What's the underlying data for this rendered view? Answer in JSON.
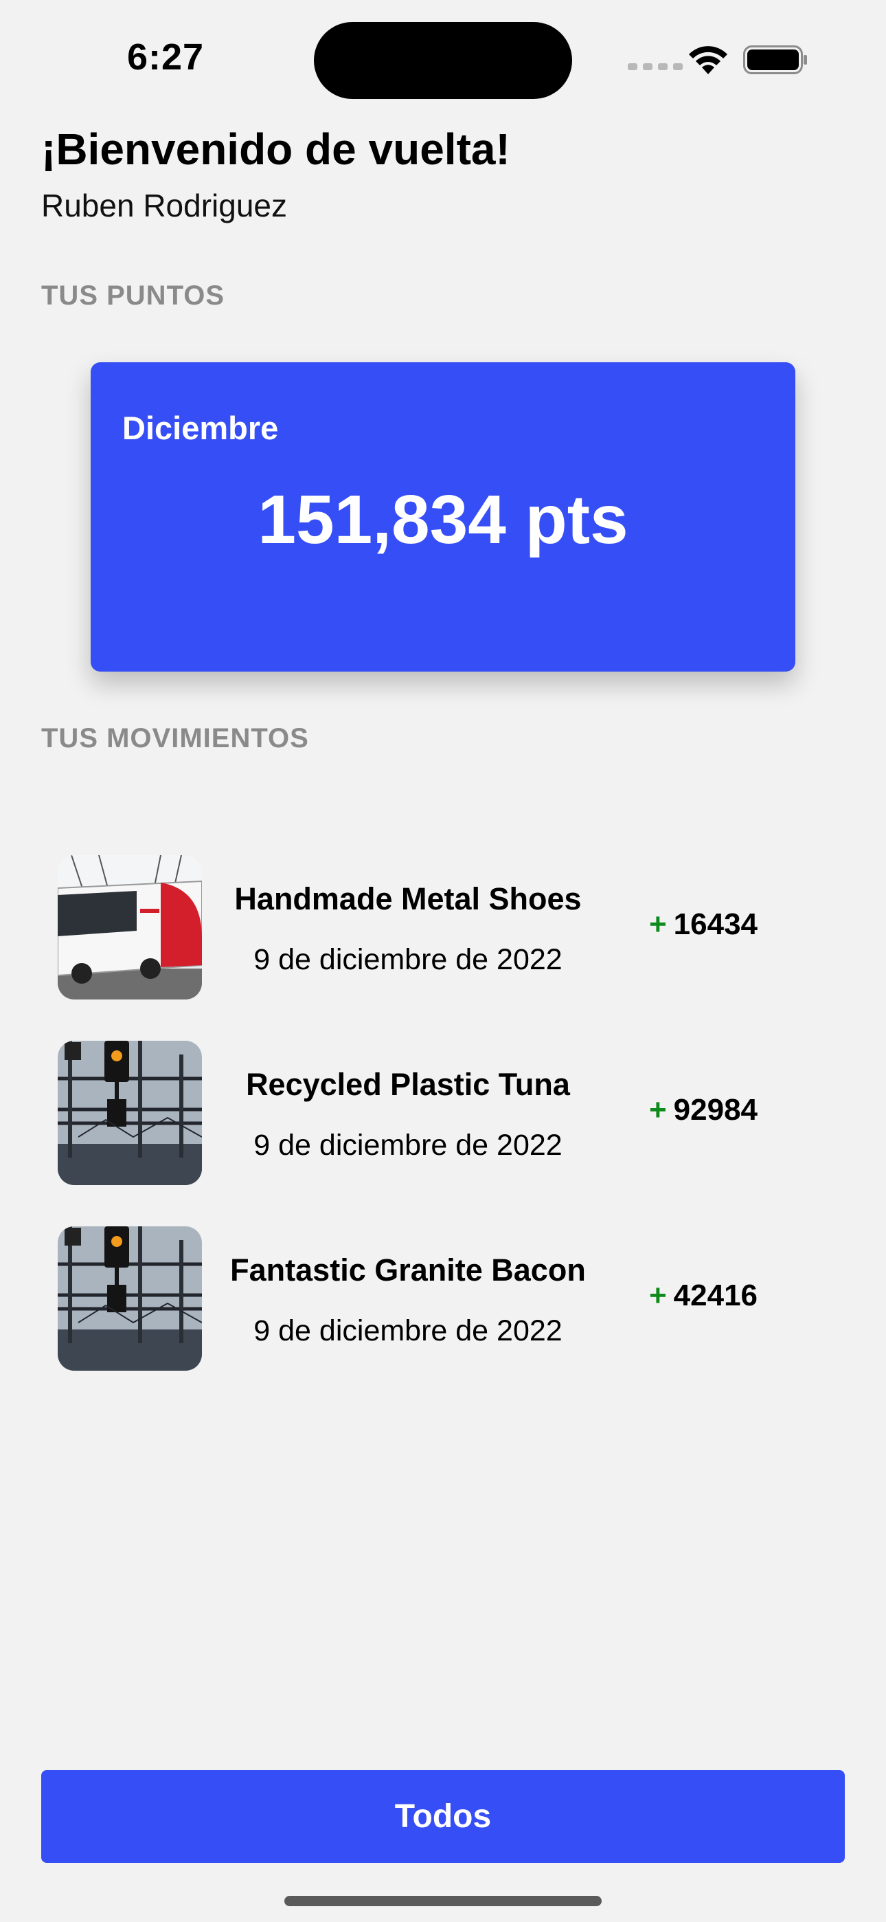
{
  "status_bar": {
    "time": "6:27",
    "icons": [
      "cellular-icon",
      "wifi-icon",
      "battery-icon"
    ]
  },
  "header": {
    "greeting": "¡Bienvenido de vuelta!",
    "user_name": "Ruben Rodriguez"
  },
  "points_section": {
    "title": "TUS PUNTOS",
    "card": {
      "month": "Diciembre",
      "points": "151,834 pts"
    }
  },
  "movements_section": {
    "title": "TUS MOVIMIENTOS",
    "items": [
      {
        "title": "Handmade Metal Shoes",
        "date": "9 de diciembre de 2022",
        "sign": "+",
        "points": "16434",
        "thumbnail": "bus-photo"
      },
      {
        "title": "Recycled Plastic Tuna",
        "date": "9 de diciembre de 2022",
        "sign": "+",
        "points": "92984",
        "thumbnail": "railway-signal-photo"
      },
      {
        "title": "Fantastic Granite Bacon",
        "date": "9 de diciembre de 2022",
        "sign": "+",
        "points": "42416",
        "thumbnail": "railway-signal-photo"
      }
    ]
  },
  "footer": {
    "button_label": "Todos"
  },
  "colors": {
    "accent": "#364ef5",
    "background": "#f2f2f2",
    "section_title": "#8a8a8a",
    "positive": "#0f8a1c"
  }
}
